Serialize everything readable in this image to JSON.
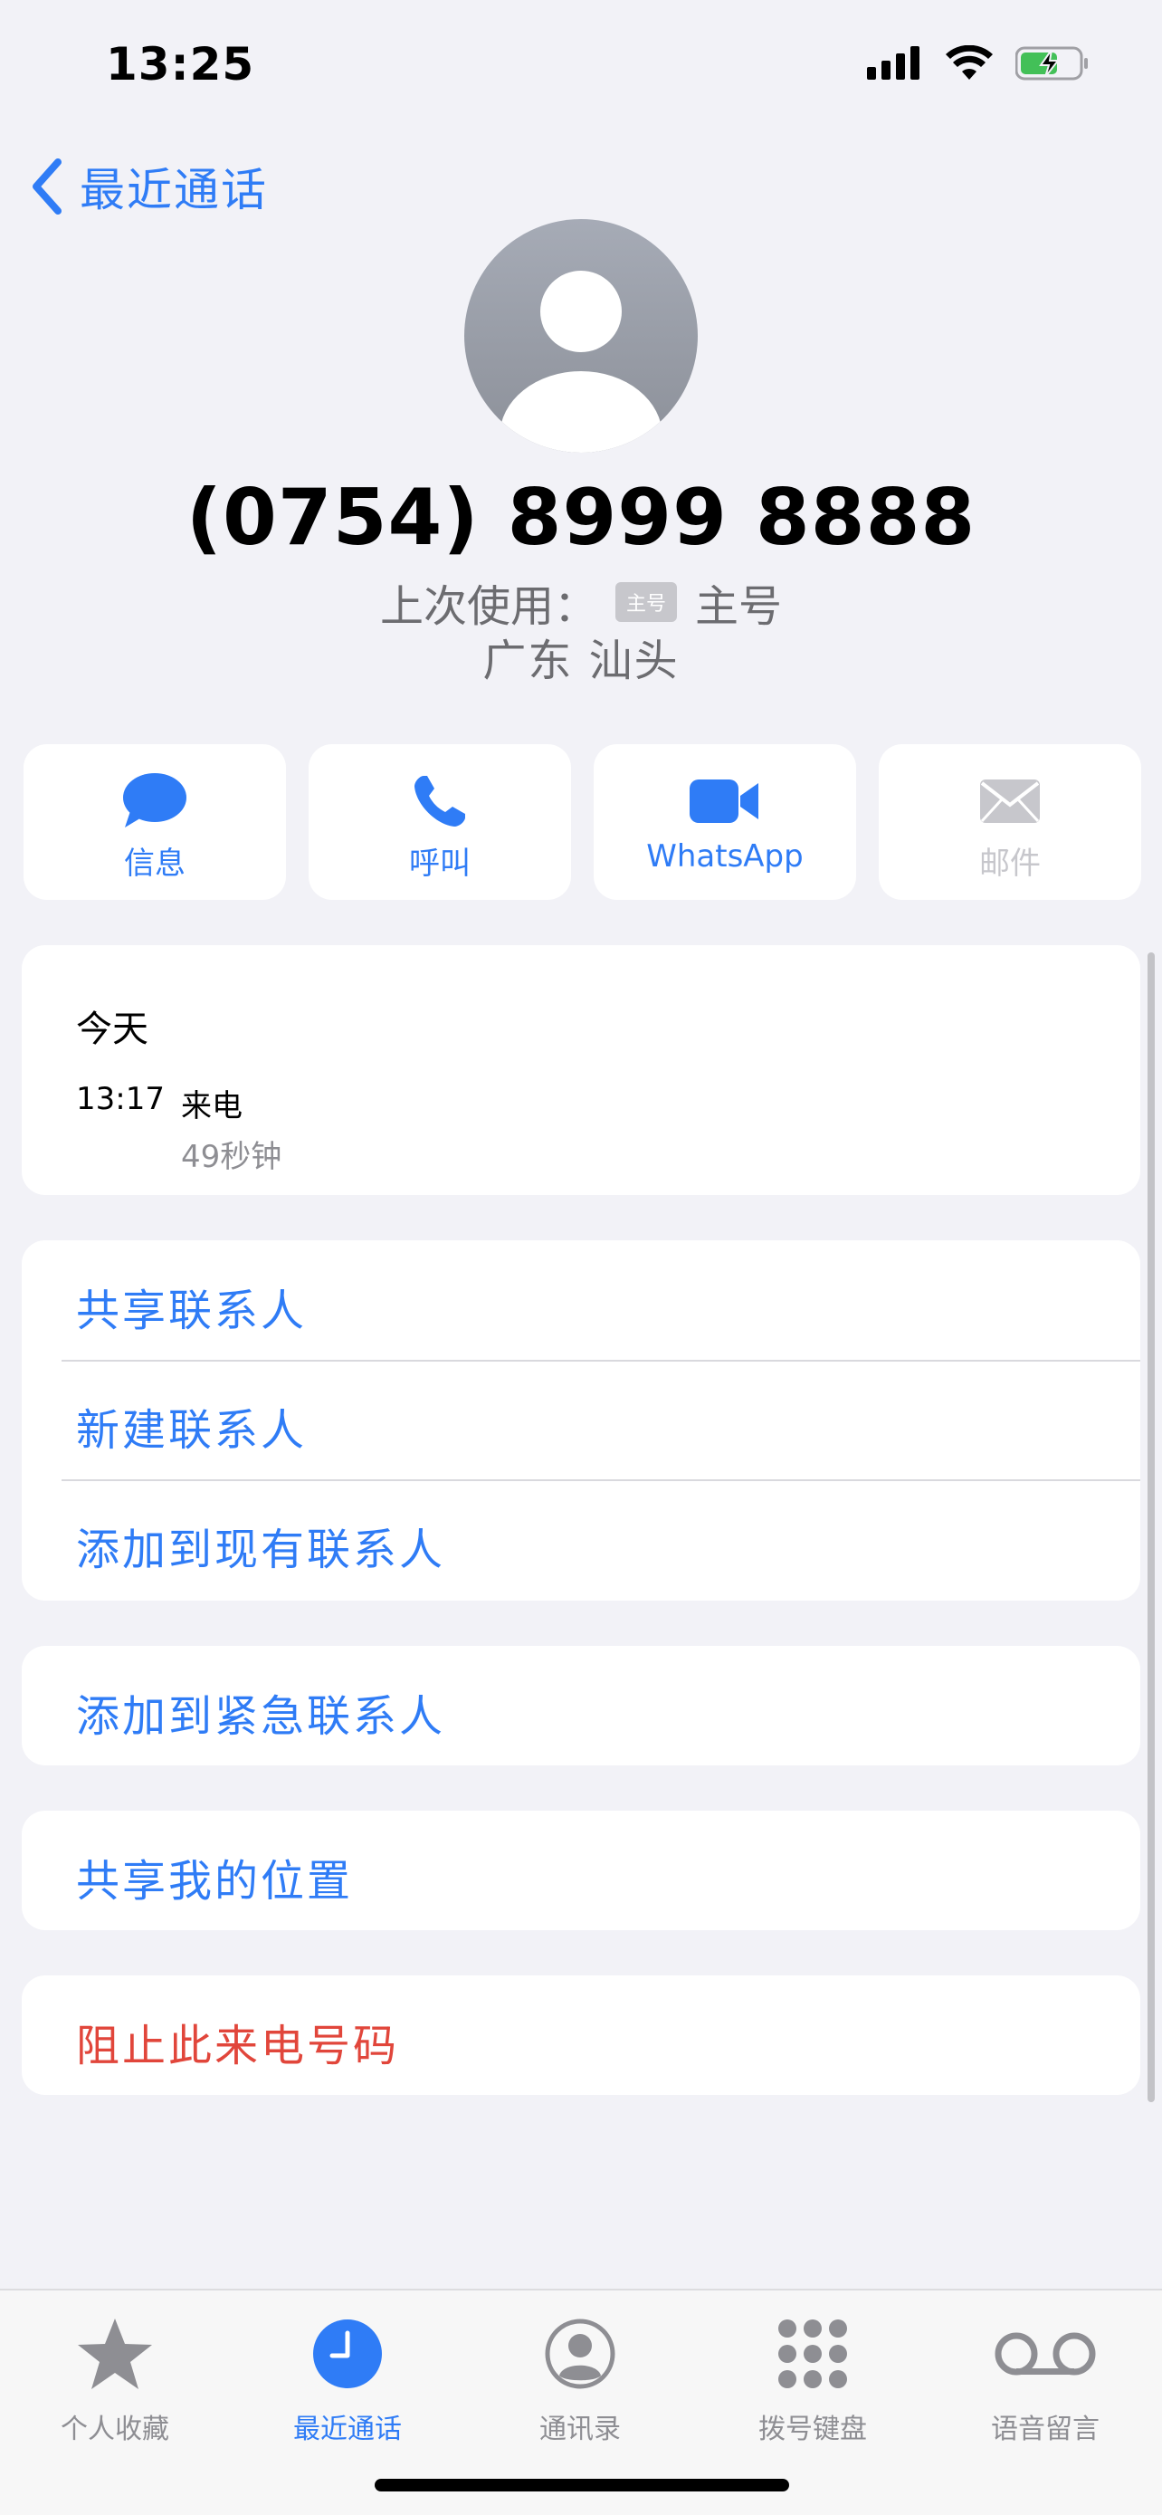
{
  "status_bar": {
    "time": "13:25",
    "icons": [
      "cellular-signal-icon",
      "wifi-icon",
      "battery-charging-icon"
    ]
  },
  "nav": {
    "back_label": "最近通话"
  },
  "contact": {
    "phone_number": "(0754) 8999 8888",
    "last_used_prefix": "上次使用：",
    "last_used_badge": "主号",
    "last_used_line": "主号",
    "location": "广东 汕头"
  },
  "actions": [
    {
      "label": "信息",
      "icon": "message-bubble-icon",
      "enabled": true
    },
    {
      "label": "呼叫",
      "icon": "phone-icon",
      "enabled": true
    },
    {
      "label": "WhatsApp",
      "icon": "video-camera-icon",
      "enabled": true
    },
    {
      "label": "邮件",
      "icon": "mail-icon",
      "enabled": false
    }
  ],
  "recent_call": {
    "day": "今天",
    "time": "13:17",
    "type": "来电",
    "duration": "49秒钟"
  },
  "options_group1": [
    "共享联系人",
    "新建联系人",
    "添加到现有联系人"
  ],
  "options_group2": [
    "添加到紧急联系人"
  ],
  "options_group3": [
    "共享我的位置"
  ],
  "options_group4": [
    "阻止此来电号码"
  ],
  "tab_bar": [
    {
      "label": "个人收藏",
      "icon": "star-icon",
      "active": false
    },
    {
      "label": "最近通话",
      "icon": "clock-icon",
      "active": true
    },
    {
      "label": "通讯录",
      "icon": "contact-icon",
      "active": false
    },
    {
      "label": "拨号键盘",
      "icon": "keypad-icon",
      "active": false
    },
    {
      "label": "语音留言",
      "icon": "voicemail-icon",
      "active": false
    }
  ],
  "colors": {
    "accent": "#2f7cf6",
    "destructive": "#e1463b",
    "background": "#f2f2f7"
  }
}
